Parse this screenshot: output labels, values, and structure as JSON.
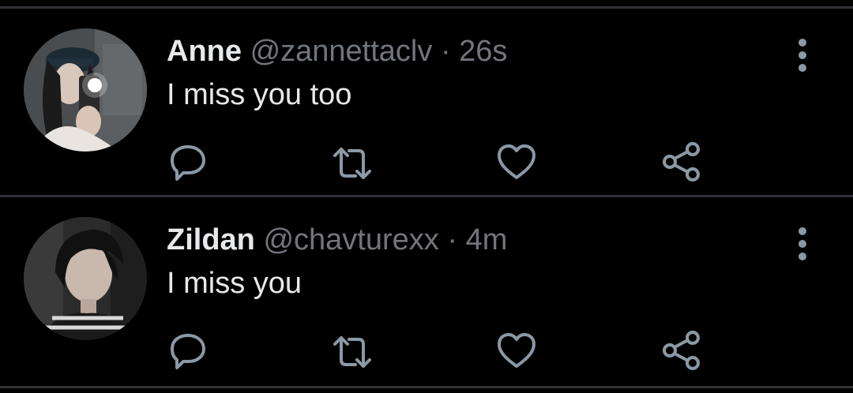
{
  "tweets": [
    {
      "name": "Anne",
      "handle": "@zannettaclv",
      "separator": "·",
      "time": "26s",
      "text": "I miss you too",
      "avatar_icon": "profile-photo-anne"
    },
    {
      "name": "Zildan",
      "handle": "@chavturexx",
      "separator": "·",
      "time": "4m",
      "text": "I miss you",
      "avatar_icon": "profile-photo-zildan"
    }
  ],
  "actions": [
    "reply-icon",
    "retweet-icon",
    "like-icon",
    "share-icon"
  ],
  "colors": {
    "background": "#000000",
    "name": "#e7e9ea",
    "secondary": "#71767b",
    "divider": "#2f3336",
    "icon": "#8b98a5"
  }
}
